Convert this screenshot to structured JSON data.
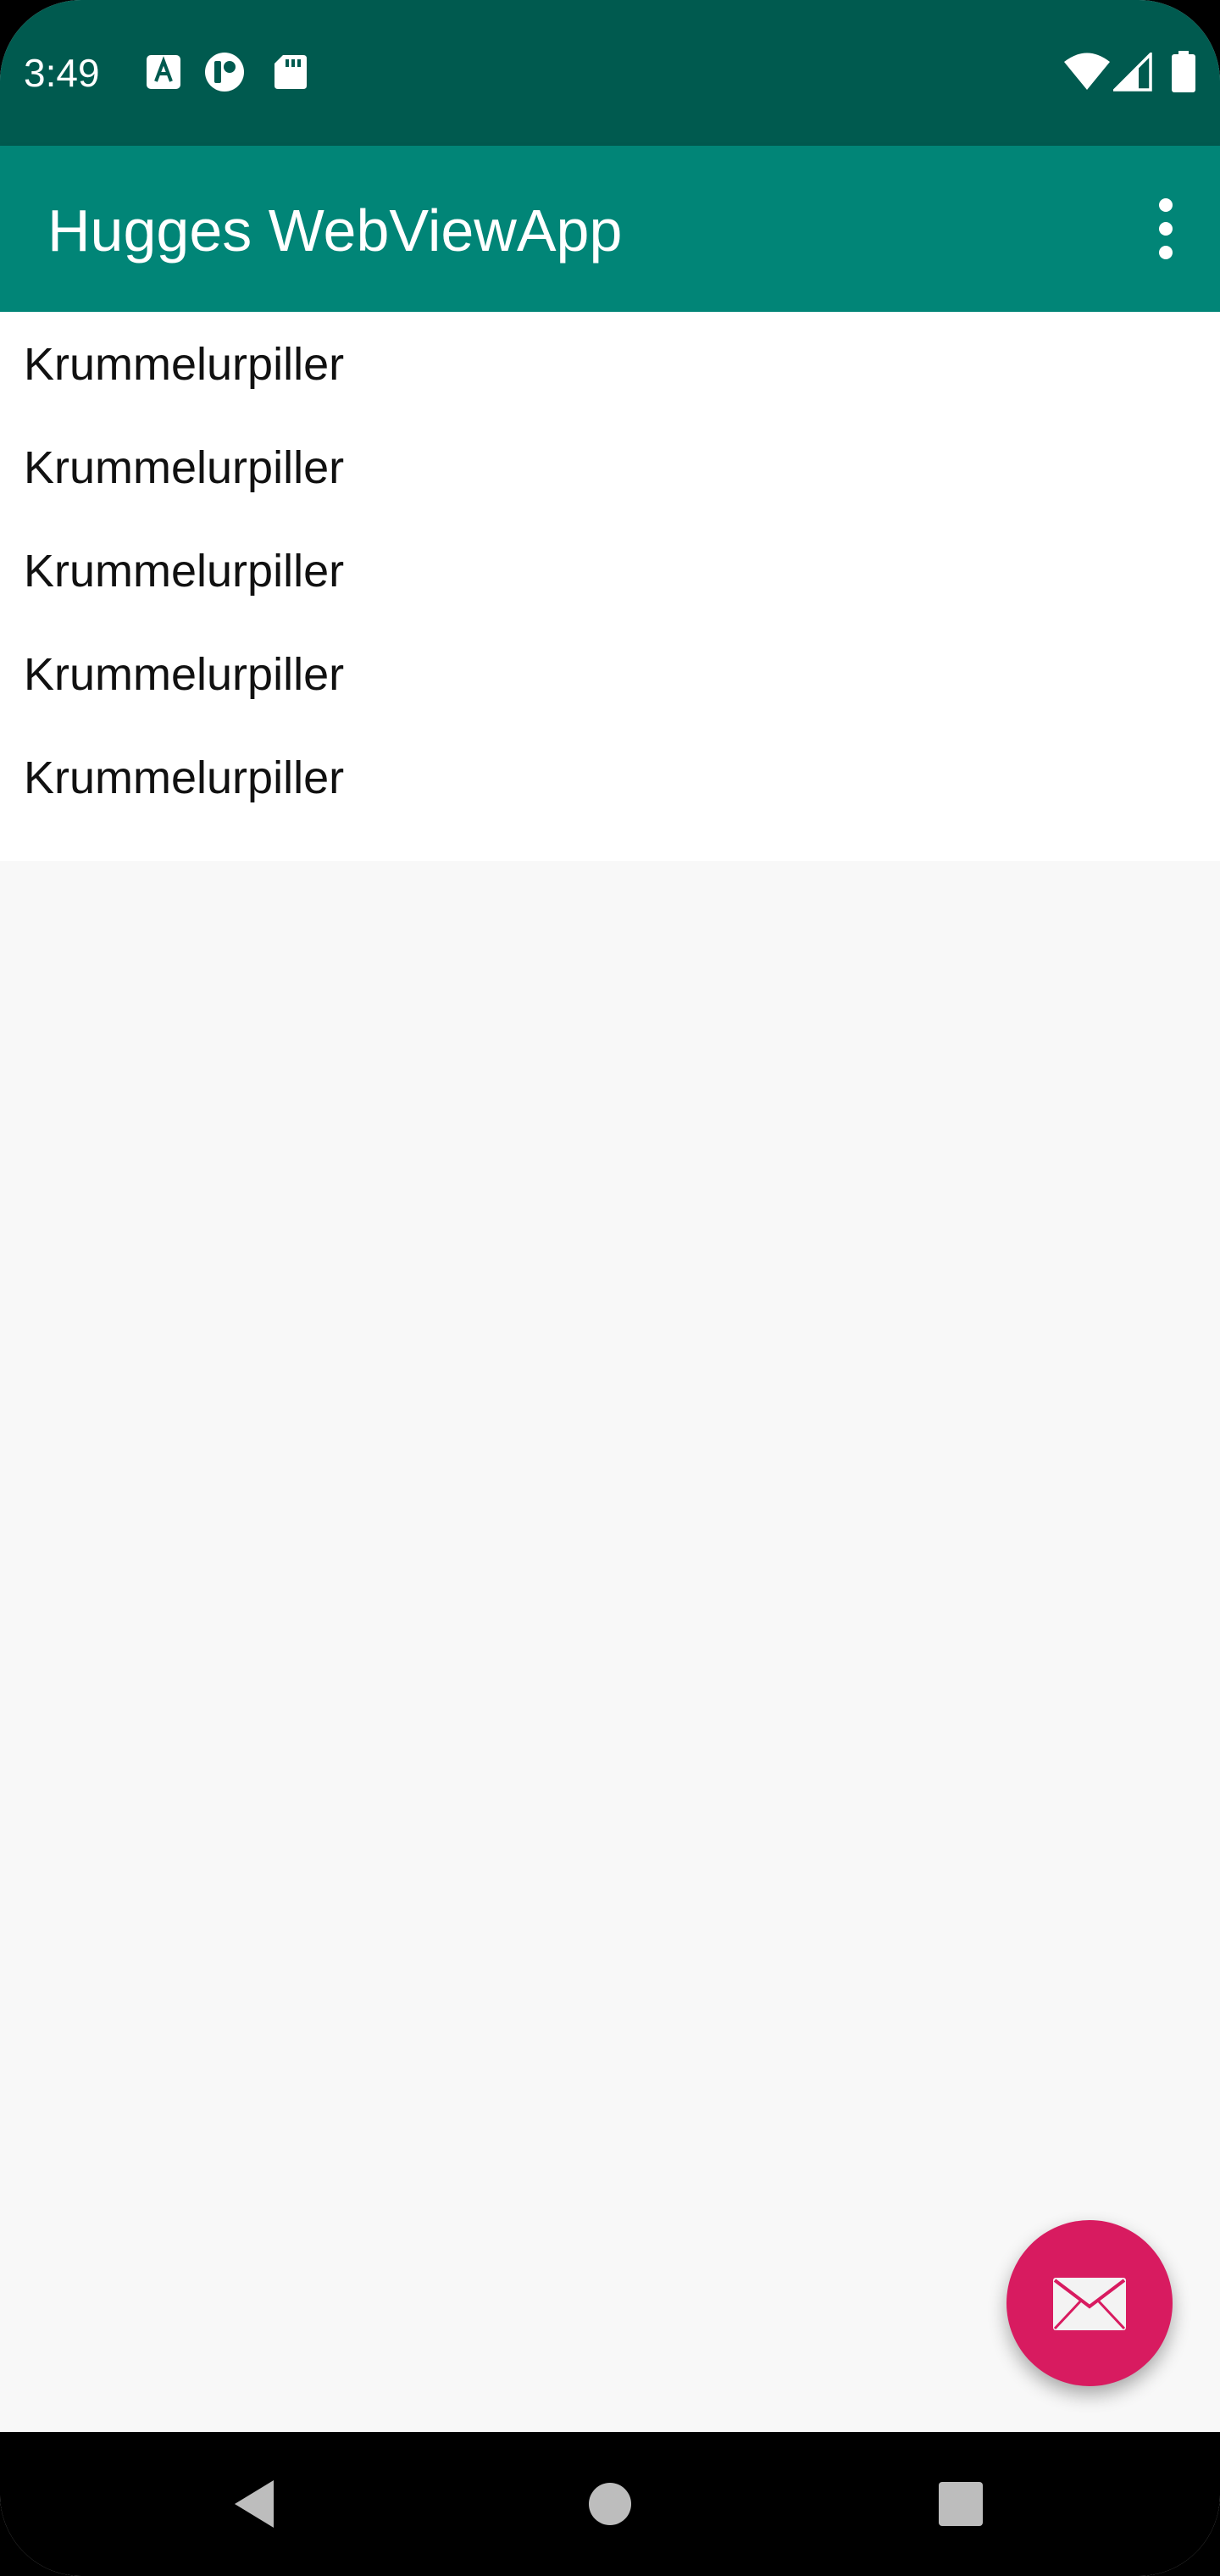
{
  "status_bar": {
    "time": "3:49",
    "left_icons": [
      "keyboard-a-icon",
      "lens-icon",
      "sd-card-icon"
    ],
    "right_icons": [
      "wifi-icon",
      "cell-signal-icon",
      "battery-icon"
    ]
  },
  "app_bar": {
    "title": "Hugges WebViewApp",
    "menu_icon": "more-vert-icon"
  },
  "list": {
    "items": [
      "Krummelurpiller",
      "Krummelurpiller",
      "Krummelurpiller",
      "Krummelurpiller",
      "Krummelurpiller"
    ]
  },
  "fab": {
    "icon": "email-icon"
  },
  "nav_bar": {
    "buttons": [
      "back-icon",
      "home-icon",
      "recents-icon"
    ]
  },
  "colors": {
    "status_bar": "#005a4f",
    "app_bar": "#018577",
    "fab": "#d81b60",
    "background": "#f8f8f8"
  }
}
